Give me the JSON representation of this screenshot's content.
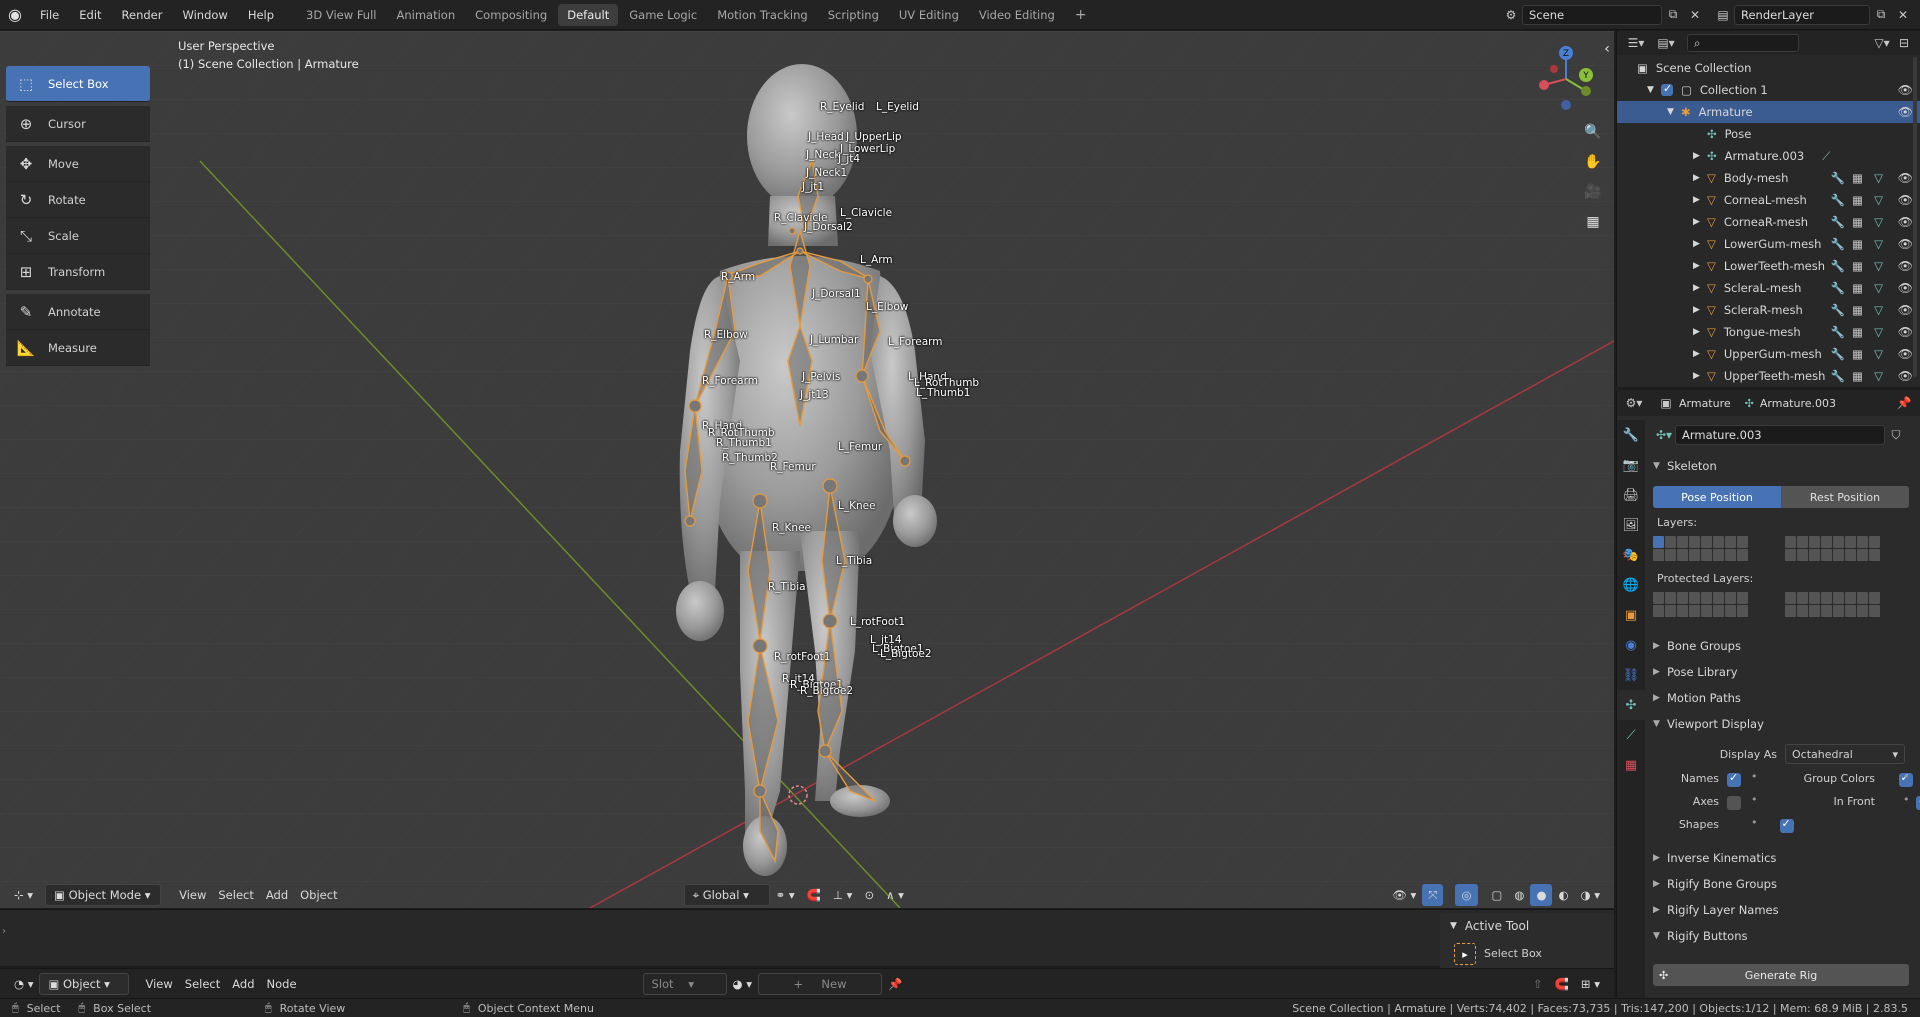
{
  "topbar": {
    "menus": [
      "File",
      "Edit",
      "Render",
      "Window",
      "Help"
    ],
    "workspaces": [
      "3D View Full",
      "Animation",
      "Compositing",
      "Default",
      "Game Logic",
      "Motion Tracking",
      "Scripting",
      "UV Editing",
      "Video Editing"
    ],
    "active_workspace": "Default",
    "add_workspace": "+",
    "scene": "Scene",
    "view_layer": "RenderLayer"
  },
  "toolbar": {
    "tools": [
      "Select Box",
      "Cursor",
      "Move",
      "Rotate",
      "Scale",
      "Transform",
      "Annotate",
      "Measure"
    ],
    "active": "Select Box"
  },
  "viewport": {
    "perspective": "User Perspective",
    "collection": "(1) Scene Collection | Armature",
    "gizmo_axes": [
      "Z",
      "Y",
      "X"
    ],
    "bone_labels": [
      "R_Eyelid",
      "L_Eyelid",
      "J_Head",
      "J_UpperLip",
      "J_LowerLip",
      "J_Neck",
      "J_jt4",
      "J_Neck1",
      "J_jt1",
      "R_Clavicle",
      "L_Clavicle",
      "J_Dorsal2",
      "R_Arm",
      "L_Arm",
      "J_Dorsal1",
      "L_Elbow",
      "R_Elbow",
      "J_Lumbar",
      "L_Forearm",
      "R_Forearm",
      "J_Pelvis",
      "L_Hand",
      "L_RotThumb",
      "L_Thumb1",
      "J_jt13",
      "L_Femur",
      "R_Hand",
      "R_RotThumb",
      "R_Thumb1",
      "R_Thumb2",
      "R_Femur",
      "L_Knee",
      "R_Knee",
      "L_Tibia",
      "R_Tibia",
      "L_rotFoot1",
      "L_jt14",
      "L_Bigtoe1",
      "L_Bigtoe2",
      "R_rotFoot1",
      "R_jt14",
      "R_Bigtoe1",
      "R_Bigtoe2"
    ]
  },
  "vp_header": {
    "mode": "Object Mode",
    "menus": [
      "View",
      "Select",
      "Add",
      "Object"
    ],
    "orientation": "Global"
  },
  "active_tool_panel": {
    "title": "Active Tool",
    "tool": "Select Box"
  },
  "node_header": {
    "mode": "Object",
    "menus": [
      "View",
      "Select",
      "Add",
      "Node"
    ],
    "slot": "Slot",
    "new_label": "New"
  },
  "statusbar": {
    "select": "Select",
    "box_select": "Box Select",
    "rotate_view": "Rotate View",
    "context_menu": "Object Context Menu",
    "stats": "Scene Collection | Armature | Verts:74,402 | Faces:73,735 | Tris:147,200 | Objects:1/12 | Mem: 68.9 MiB | 2.83.5"
  },
  "outliner": {
    "root": "Scene Collection",
    "collection": "Collection 1",
    "armature": "Armature",
    "pose": "Pose",
    "armature_data": "Armature.003",
    "meshes": [
      "Body-mesh",
      "CorneaL-mesh",
      "CorneaR-mesh",
      "LowerGum-mesh",
      "LowerTeeth-mesh",
      "ScleraL-mesh",
      "ScleraR-mesh",
      "Tongue-mesh",
      "UpperGum-mesh",
      "UpperTeeth-mesh"
    ]
  },
  "properties": {
    "breadcrumb_object": "Armature",
    "breadcrumb_data": "Armature.003",
    "datablock": "Armature.003",
    "skeleton_title": "Skeleton",
    "pose_position": "Pose Position",
    "rest_position": "Rest Position",
    "layers_label": "Layers:",
    "protected_layers_label": "Protected Layers:",
    "collapsed_panels_1": [
      "Bone Groups",
      "Pose Library",
      "Motion Paths"
    ],
    "viewport_display_title": "Viewport Display",
    "display_as_label": "Display As",
    "display_as_value": "Octahedral",
    "names_label": "Names",
    "names_on": true,
    "group_colors_label": "Group Colors",
    "group_colors_on": true,
    "axes_label": "Axes",
    "axes_on": false,
    "in_front_label": "In Front",
    "in_front_on": true,
    "shapes_label": "Shapes",
    "shapes_on": true,
    "collapsed_panels_2": [
      "Inverse Kinematics",
      "Rigify Bone Groups",
      "Rigify Layer Names"
    ],
    "rigify_buttons_title": "Rigify Buttons",
    "generate_rig": "Generate Rig"
  },
  "colors": {
    "accent": "#4772b3",
    "selection_row": "#3b5c91",
    "bone": "#e69a3c",
    "grid_x_axis": "#a8383e",
    "grid_y_axis": "#6e8b2a"
  }
}
